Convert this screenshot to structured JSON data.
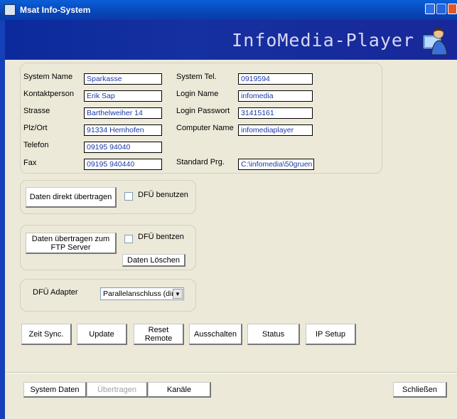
{
  "window": {
    "title": "Msat Info-System",
    "banner_title": "InfoMedia-Player"
  },
  "system": {
    "system_name": {
      "label": "System Name",
      "value": "Sparkasse"
    },
    "kontaktperson": {
      "label": "Kontaktperson",
      "value": "Erik Sap"
    },
    "strasse": {
      "label": "Strasse",
      "value": "Barthelweiher 14"
    },
    "plz_ort": {
      "label": "Plz/Ort",
      "value": "91334 Hemhofen"
    },
    "telefon": {
      "label": "Telefon",
      "value": "09195 94040"
    },
    "fax": {
      "label": "Fax",
      "value": "09195 940440"
    },
    "system_tel": {
      "label": "System Tel.",
      "value": "0919594"
    },
    "login_name": {
      "label": "Login Name",
      "value": "infomedia"
    },
    "login_passwort": {
      "label": "Login Passwort",
      "value": "31415161"
    },
    "computer_name": {
      "label": "Computer Name",
      "value": "infomediaplayer"
    },
    "standard_prg": {
      "label": "Standard Prg.",
      "value": "C:\\infomedia\\50gruen"
    }
  },
  "transfer": {
    "direct_button": "Daten direkt übertragen",
    "dfu_benutzen": "DFÜ benutzen",
    "ftp_button": "Daten übertragen zum\nFTP Server",
    "dfu_bentzen": "DFÜ bentzen",
    "delete_button": "Daten Löschen"
  },
  "adapter": {
    "label": "DFÜ Adapter",
    "selected": "Parallelanschluss (dir"
  },
  "actions": {
    "zeit_sync": "Zeit Sync.",
    "update": "Update",
    "reset_remote": "Reset\nRemote",
    "ausschalten": "Ausschalten",
    "status": "Status",
    "ip_setup": "IP Setup"
  },
  "footer": {
    "system_daten": "System Daten",
    "uebertragen": "Übertragen",
    "kanaele": "Kanäle",
    "schliessen": "Schließen"
  },
  "icons": {
    "app": "app-icon",
    "person": "user-computer-icon",
    "minimize": "minimize-icon",
    "maximize": "maximize-icon",
    "close": "close-icon",
    "dropdown": "chevron-down-icon"
  }
}
